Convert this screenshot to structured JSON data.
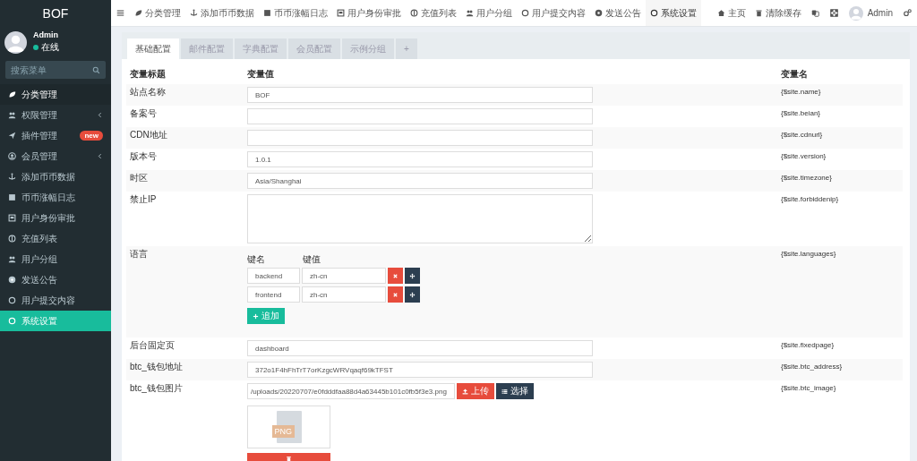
{
  "sidebar": {
    "logo": "BOF",
    "user": {
      "name": "Admin",
      "status": "在线",
      "online": true
    },
    "search": {
      "placeholder": "搜索菜单"
    },
    "items": [
      {
        "label": "分类管理",
        "selected": false,
        "hovered": true
      },
      {
        "label": "权限管理",
        "selected": false,
        "hovered": false,
        "expanded": false
      },
      {
        "label": "插件管理",
        "selected": false,
        "hovered": false,
        "badge": "new"
      },
      {
        "label": "会员管理",
        "selected": false,
        "hovered": false,
        "expanded": false
      },
      {
        "label": "添加币币数据",
        "selected": false,
        "hovered": false
      },
      {
        "label": "币币涨幅日志",
        "selected": false,
        "hovered": false
      },
      {
        "label": "用户身份审批",
        "selected": false,
        "hovered": false
      },
      {
        "label": "充值列表",
        "selected": false,
        "hovered": false
      },
      {
        "label": "用户分组",
        "selected": false,
        "hovered": false
      },
      {
        "label": "发送公告",
        "selected": false,
        "hovered": false
      },
      {
        "label": "用户提交内容",
        "selected": false,
        "hovered": false
      },
      {
        "label": "系统设置",
        "selected": true,
        "hovered": false
      }
    ]
  },
  "topnav": {
    "items": [
      {
        "label": "分类管理",
        "selected": false
      },
      {
        "label": "添加币币数据",
        "selected": false
      },
      {
        "label": "币币涨幅日志",
        "selected": false
      },
      {
        "label": "用户身份审批",
        "selected": false
      },
      {
        "label": "充值列表",
        "selected": false
      },
      {
        "label": "用户分组",
        "selected": false
      },
      {
        "label": "用户提交内容",
        "selected": false
      },
      {
        "label": "发送公告",
        "selected": false
      },
      {
        "label": "系统设置",
        "selected": true
      }
    ],
    "right": [
      {
        "label": "主页"
      },
      {
        "label": "清除缓存"
      }
    ],
    "user": "Admin"
  },
  "tabs": [
    {
      "label": "基础配置",
      "selected": true
    },
    {
      "label": "邮件配置",
      "selected": false
    },
    {
      "label": "字典配置",
      "selected": false
    },
    {
      "label": "会员配置",
      "selected": false
    },
    {
      "label": "示例分组",
      "selected": false
    },
    {
      "label": "+",
      "selected": false
    }
  ],
  "table": {
    "columns": [
      "变量标题",
      "变量值",
      "变量名"
    ],
    "rows": [
      {
        "kind": "text",
        "title": "站点名称",
        "value": "BOF",
        "name": "{$site.name}"
      },
      {
        "kind": "text",
        "title": "备案号",
        "name": "{$site.beian}"
      },
      {
        "kind": "text",
        "title": "CDN地址",
        "name": "{$site.cdnurl}"
      },
      {
        "kind": "text",
        "title": "版本号",
        "value": "1.0.1",
        "name": "{$site.version}"
      },
      {
        "kind": "text",
        "title": "时区",
        "value": "Asia/Shanghai",
        "name": "{$site.timezone}"
      },
      {
        "kind": "textarea",
        "title": "禁止IP",
        "name": "{$site.forbiddenip}"
      },
      {
        "kind": "keyvalue",
        "title": "语言",
        "name": "{$site.languages}",
        "headers": [
          "键名",
          "键值"
        ],
        "pairs": [
          {
            "key": "backend",
            "value": "zh-cn"
          },
          {
            "key": "frontend",
            "value": "zh-cn"
          }
        ],
        "add_button": "追加"
      },
      {
        "kind": "text",
        "title": "后台固定页",
        "value": "dashboard",
        "name": "{$site.fixedpage}"
      },
      {
        "kind": "text",
        "title": "btc_钱包地址",
        "value": "372o1F4hFhTrT7orKzgcWRVqaqf69kTFST",
        "name": "{$site.btc_address}"
      },
      {
        "kind": "image",
        "title": "btc_钱包图片",
        "value": "/uploads/20220707/e0fdddfaa88d4a63445b101c0fb5f3e3.png",
        "name": "{$site.btc_image}",
        "upload_button": "上传",
        "choose_button": "选择",
        "thumbnail_label": "PNG"
      }
    ]
  }
}
